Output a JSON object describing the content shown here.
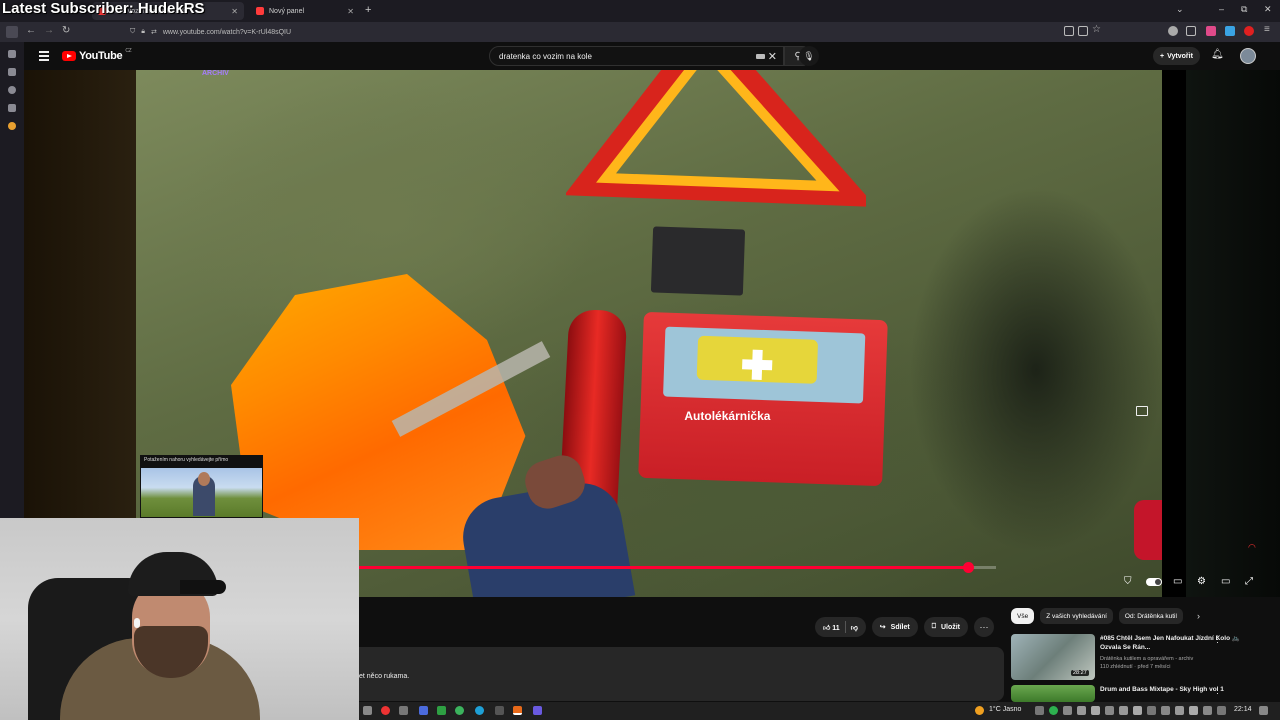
{
  "overlay": {
    "title": "Latest Subscriber: HudekRS"
  },
  "browser": {
    "tabs": [
      {
        "label": "...Co vozím na kole... Vi",
        "active": true
      },
      {
        "label": "Nový panel",
        "active": false
      }
    ],
    "url": "www.youtube.com/watch?v=K-rUl48sQIU"
  },
  "youtube": {
    "logo": "YouTube",
    "logo_country": "CZ",
    "search_value": "dratenka co vozim na kole",
    "create_label": "Vytvořit"
  },
  "video": {
    "watermark": "ARCHIV",
    "kit_label": "Autolékárnička",
    "progress_fraction": 0.968
  },
  "pip": {
    "hint": "Potažením nahoru vyhledávejte přímo"
  },
  "actions": {
    "like_count": "11",
    "share_label": "Sdílet",
    "save_label": "Uložit"
  },
  "description": {
    "text": "et něco rukama."
  },
  "chips": [
    "Vše",
    "Z vašich vyhledávání",
    "Od: Drátěnka kutil"
  ],
  "recommendations": [
    {
      "title": "#085 Chtěl Jsem Jen Nafoukat Jízdní Kolo 🚲 Ozvala Se Rán...",
      "channel": "Drátěnka kutilem a opravářem - archiv",
      "stats": "110 zhlédnutí · před 7 měsíci",
      "duration": "28:27"
    },
    {
      "title": "Drum and Bass Mixtape - Sky High vol 1",
      "channel": "",
      "stats": "",
      "duration": ""
    }
  ],
  "taskbar": {
    "weather": "1°C  Jasno",
    "time": "22:14"
  }
}
